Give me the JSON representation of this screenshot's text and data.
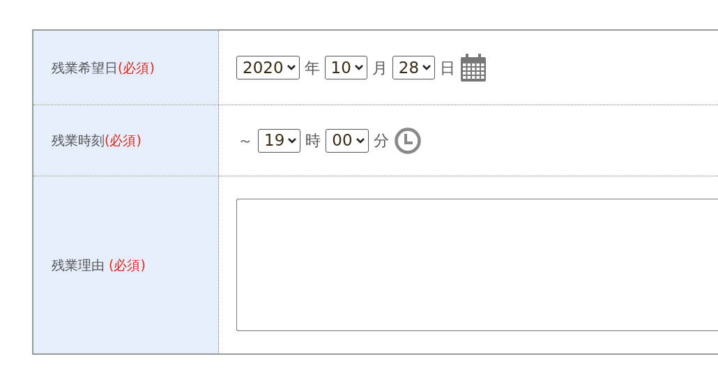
{
  "rows": [
    {
      "kind": "date",
      "label": "残業希望日",
      "required": "(必須)",
      "parts": [
        {
          "kind": "select",
          "value": "2020"
        },
        {
          "kind": "unit",
          "text": "年"
        },
        {
          "kind": "select",
          "value": "10"
        },
        {
          "kind": "unit",
          "text": "月"
        },
        {
          "kind": "select",
          "value": "28"
        },
        {
          "kind": "unit",
          "text": "日"
        }
      ]
    },
    {
      "kind": "time",
      "label": "残業時刻",
      "required": "(必須)",
      "parts": [
        {
          "kind": "unit",
          "text": "～"
        },
        {
          "kind": "select",
          "value": "19"
        },
        {
          "kind": "unit",
          "text": "時"
        },
        {
          "kind": "select",
          "value": "00"
        },
        {
          "kind": "unit",
          "text": "分"
        }
      ]
    },
    {
      "kind": "textarea",
      "label": "残業理由",
      "required": "(必須)",
      "parts": []
    }
  ]
}
